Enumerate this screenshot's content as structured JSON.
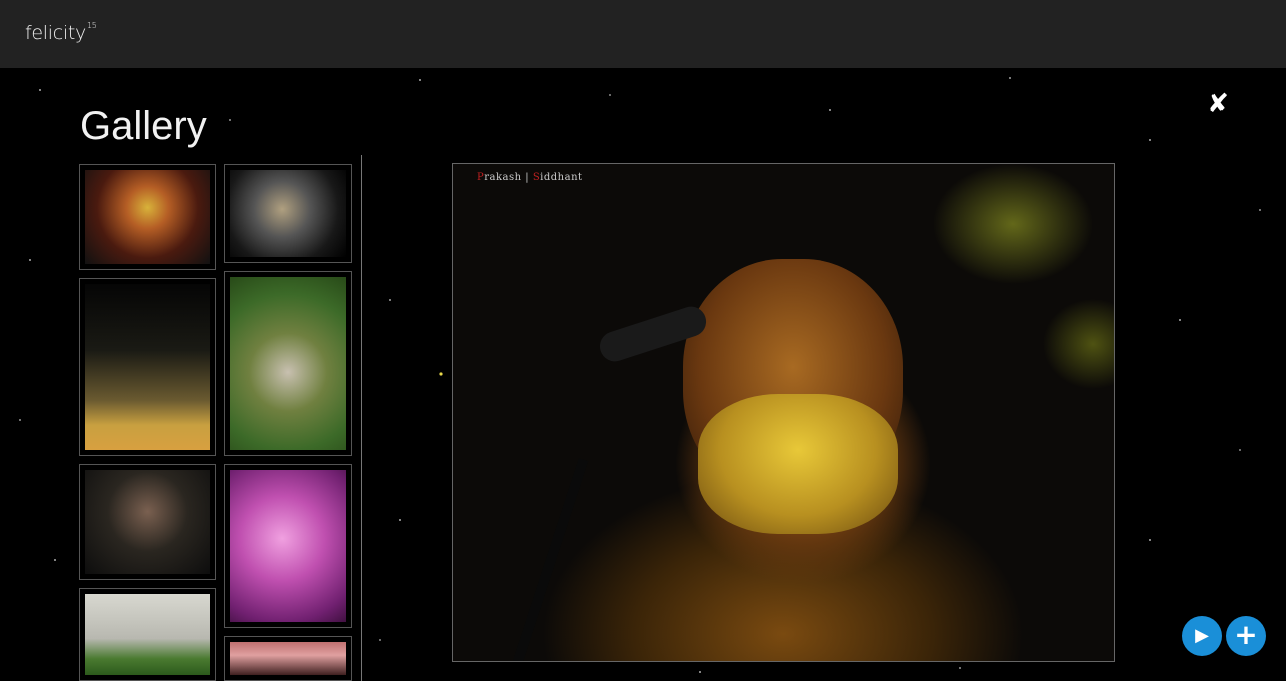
{
  "header": {
    "logo_text": "felicity",
    "logo_sup": "15"
  },
  "gallery": {
    "title": "Gallery",
    "close_icon": "✘",
    "thumbnails": [
      {
        "name": "singer-harmonica"
      },
      {
        "name": "smiling-man"
      },
      {
        "name": "guitarists-stage"
      },
      {
        "name": "painted-face"
      },
      {
        "name": "crowd"
      },
      {
        "name": "purple-guitarist"
      },
      {
        "name": "building-rappel"
      },
      {
        "name": "group-photo"
      }
    ]
  },
  "main_photo": {
    "watermark_first": "P",
    "watermark_first_rest": "rakash",
    "watermark_sep": " | ",
    "watermark_second": "S",
    "watermark_second_rest": "iddhant"
  },
  "controls": {
    "play_icon": "▶",
    "add_icon": "+"
  },
  "colors": {
    "accent": "#1a8fd8",
    "topbar": "#222222",
    "background": "#000000"
  }
}
